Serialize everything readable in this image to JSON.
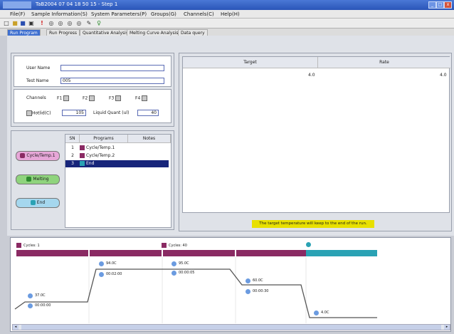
{
  "window": {
    "title": "TaB2004 07 04 18 50 15 - Step 1"
  },
  "menu": [
    "File(F)",
    "Sample Information(S)",
    "System Parameters(P)",
    "Groups(G)",
    "Channels(C)",
    "Help(H)"
  ],
  "tabs": [
    "Run Program",
    "Run Progress",
    "Quantitative Analysis",
    "Melting Curve Analysis",
    "Data query"
  ],
  "form": {
    "user_name_label": "User Name",
    "user_name_value": "",
    "test_name_label": "Test Name",
    "test_name_value": "005",
    "channels_label": "Channels",
    "channels": [
      "F1",
      "F2",
      "F3",
      "F4"
    ],
    "hotlid_label": "Hotlid(C)",
    "hotlid_value": "105",
    "liquid_label": "Liquid Quant (ul)",
    "liquid_value": "40"
  },
  "side_buttons": [
    "Cycle/Temp.1",
    "Melting",
    "End"
  ],
  "program_table": {
    "headers": [
      "SN",
      "Programs",
      "Notes"
    ],
    "rows": [
      {
        "sn": "1",
        "program": "Cycle/Temp.1"
      },
      {
        "sn": "2",
        "program": "Cycle/Temp.2"
      },
      {
        "sn": "3",
        "program": "End"
      }
    ]
  },
  "target_rate": {
    "headers": [
      "Target",
      "Rate"
    ],
    "target_value": "4.0",
    "rate_value": "4.0"
  },
  "message": "The target temperature will keep to the end of the run.",
  "cycles": [
    {
      "label": "Cycles: 1"
    },
    {
      "label": "Cycles: 40"
    }
  ],
  "stages": [
    {
      "temp": "37.0C",
      "time": "00:00:00"
    },
    {
      "temp": "94.0C",
      "time": "00:02:00"
    },
    {
      "temp": "95.0C",
      "time": "00:00:05"
    },
    {
      "temp": "60.0C",
      "time": "00:00:30"
    },
    {
      "temp": "4.0C"
    }
  ],
  "colors": {
    "segment": "#8a2a63",
    "end_segment": "#2aa2b4",
    "title_bar": "#2a55b8",
    "message_bg": "#e8e000"
  },
  "toolbar_icons": [
    "new-icon",
    "open-icon",
    "save-icon",
    "print-icon",
    "run-icon",
    "disc-icon",
    "disc-icon",
    "disc-icon",
    "disc-icon",
    "tool-icon",
    "lamp-icon"
  ]
}
